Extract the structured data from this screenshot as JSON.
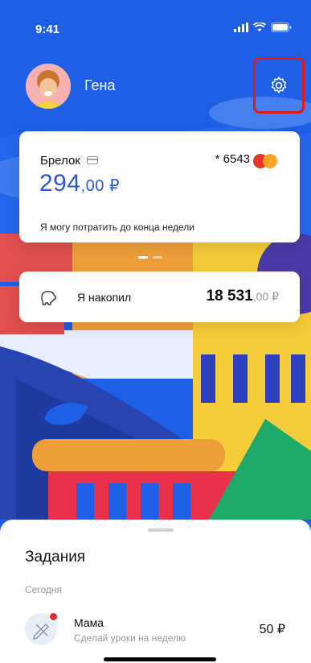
{
  "status_bar": {
    "time": "9:41"
  },
  "profile": {
    "name": "Гена"
  },
  "card": {
    "title": "Брелок",
    "number": "* 6543",
    "balance_int": "294",
    "balance_dec": ",00 ₽",
    "note": "Я могу потратить до конца недели"
  },
  "savings": {
    "label": "Я накопил",
    "amount_int": "18 531",
    "amount_dec": ",00 ₽"
  },
  "tasks": {
    "title": "Задания",
    "section": "Сегодня",
    "items": [
      {
        "name": "Мама",
        "description": "Сделай уроки на неделю",
        "amount": "50 ₽"
      }
    ]
  },
  "colors": {
    "primary": "#2c56d8",
    "background": "#1e5fe6",
    "highlight": "#e01a1a"
  },
  "icons": [
    "settings-gear-icon",
    "card-icon",
    "mastercard-icon",
    "piggy-bank-icon",
    "task-pencil-icon"
  ]
}
